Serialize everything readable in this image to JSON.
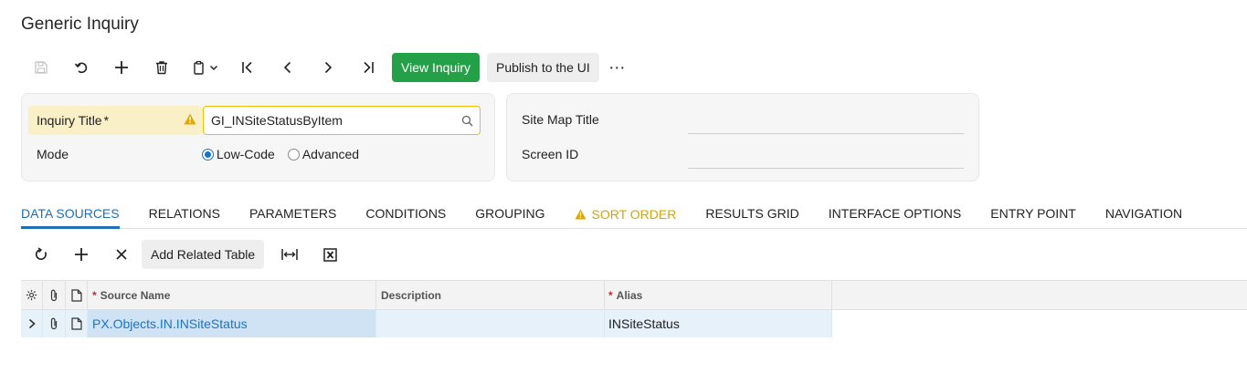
{
  "page": {
    "title": "Generic Inquiry"
  },
  "toolbar": {
    "view_inquiry": "View Inquiry",
    "publish": "Publish to the UI",
    "more": "⋯"
  },
  "summary": {
    "inquiry_title_label": "Inquiry Title",
    "required_star": "*",
    "inquiry_title_value": "GI_INSiteStatusByItem",
    "mode_label": "Mode",
    "mode_options": [
      "Low-Code",
      "Advanced"
    ],
    "mode_selected": "Low-Code",
    "site_map_title_label": "Site Map Title",
    "site_map_title_value": "",
    "screen_id_label": "Screen ID",
    "screen_id_value": ""
  },
  "tabs": [
    {
      "label": "DATA SOURCES",
      "active": true
    },
    {
      "label": "RELATIONS"
    },
    {
      "label": "PARAMETERS"
    },
    {
      "label": "CONDITIONS"
    },
    {
      "label": "GROUPING"
    },
    {
      "label": "SORT ORDER",
      "warning": true
    },
    {
      "label": "RESULTS GRID"
    },
    {
      "label": "INTERFACE OPTIONS"
    },
    {
      "label": "ENTRY POINT"
    },
    {
      "label": "NAVIGATION"
    }
  ],
  "grid_toolbar": {
    "add_related_table": "Add Related Table"
  },
  "grid": {
    "columns": {
      "source_name": "Source Name",
      "description": "Description",
      "alias": "Alias"
    },
    "required_star": "*",
    "rows": [
      {
        "source_name": "PX.Objects.IN.INSiteStatus",
        "description": "",
        "alias": "INSiteStatus"
      }
    ]
  },
  "colors": {
    "primary": "#24a148",
    "accent": "#1d6fb8",
    "warning": "#d9a400",
    "required_bg": "#faf0c8"
  }
}
